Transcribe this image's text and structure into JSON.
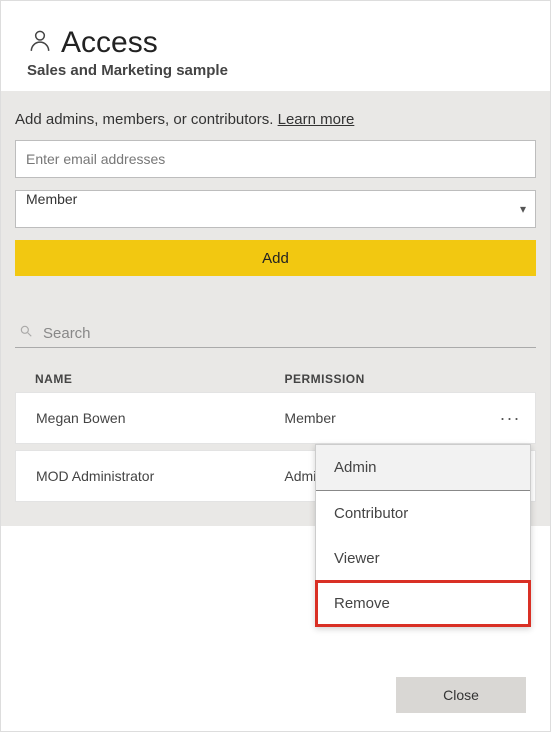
{
  "header": {
    "title": "Access",
    "subtitle": "Sales and Marketing sample"
  },
  "form": {
    "instruction": "Add admins, members, or contributors.",
    "learn_more": "Learn more",
    "email_placeholder": "Enter email addresses",
    "role_value": "Member",
    "add_label": "Add"
  },
  "search": {
    "placeholder": "Search"
  },
  "table": {
    "head_name": "NAME",
    "head_permission": "PERMISSION",
    "rows": [
      {
        "name": "Megan Bowen",
        "permission": "Member"
      },
      {
        "name": "MOD Administrator",
        "permission": "Admin"
      }
    ]
  },
  "menu": {
    "items": [
      "Admin",
      "Contributor",
      "Viewer",
      "Remove"
    ]
  },
  "footer": {
    "close": "Close"
  }
}
